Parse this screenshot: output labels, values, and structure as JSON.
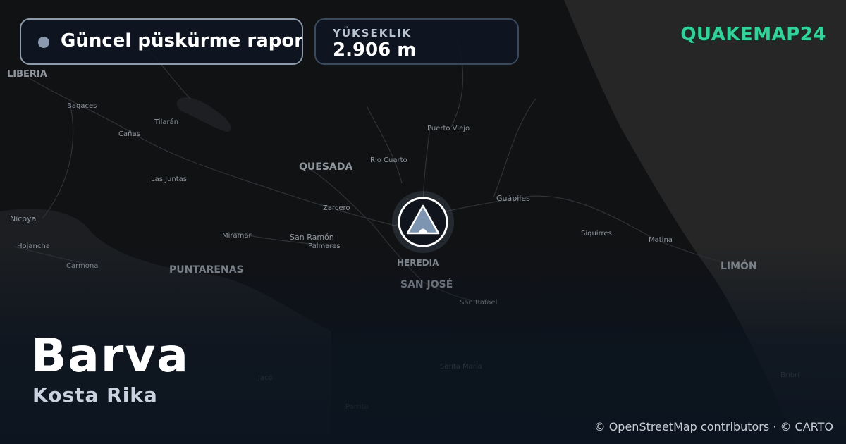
{
  "header": {
    "status_label": "Güncel püskürme raporu",
    "elevation_label": "YÜKSEKLIK",
    "elevation_value": "2.906 m",
    "brand": "QUAKEMAP24"
  },
  "volcano": {
    "name": "Barva",
    "country": "Kosta Rika"
  },
  "map": {
    "labels": {
      "liberia": "LIBERIA",
      "bagaces": "Bagaces",
      "tilaran": "Tilarán",
      "canas": "Cañas",
      "puerto_viejo": "Puerto Viejo",
      "quesada": "QUESADA",
      "rio_cuarto": "Rio Cuarto",
      "las_juntas": "Las Juntas",
      "guapiles": "Guápiles",
      "zarcero": "Zarcero",
      "nicoya": "Nicoya",
      "siquirres": "Siquirres",
      "miramar": "Miramar",
      "san_ramon": "San Ramón",
      "matina": "Matina",
      "palmares": "Palmares",
      "hojancha": "Hojancha",
      "heredia": "HEREDIA",
      "limon": "LIMÓN",
      "carmona": "Carmona",
      "puntarenas": "PUNTARENAS",
      "san_jose": "SAN JOSÉ",
      "san_rafael": "San Rafael",
      "santa_maria": "Santa María",
      "jaco": "Jacó",
      "bribri": "Bribri",
      "parrita": "Parrita"
    },
    "attribution": "© OpenStreetMap contributors · © CARTO",
    "colors": {
      "land": "#111214",
      "sea": "#262626",
      "road": "#2e3034",
      "marker_fill": "#7d95b0",
      "accent": "#32d29a"
    }
  }
}
